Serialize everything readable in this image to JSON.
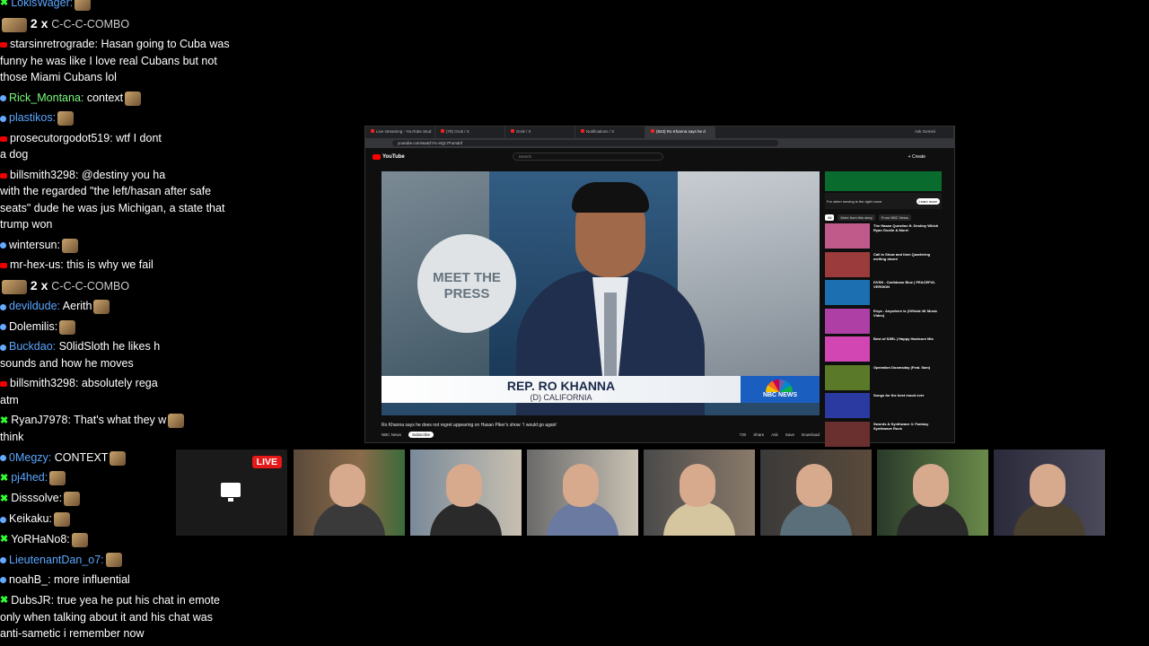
{
  "chat": {
    "top_messages": [
      {
        "platform": "kick",
        "user": "LokisWager",
        "text": "",
        "user_color": "#5aa7ff"
      },
      {
        "platform": "combo",
        "count": "2 x",
        "text": "C-C-C-COMBO"
      },
      {
        "platform": "yt",
        "user": "starsinretrograde",
        "text": "Hasan going to Cuba was funny he was like I love real Cubans but not those Miami Cubans lol",
        "user_color": "#ffffff"
      },
      {
        "platform": "tw",
        "user": "Rick_Montana",
        "text": "context",
        "user_color": "#7cfc7c"
      },
      {
        "platform": "tw",
        "user": "plastikos",
        "text": "",
        "user_color": "#5aa7ff"
      },
      {
        "platform": "yt",
        "user": "prosecutorgodot519",
        "text": "wtf I dont",
        "tail": "a dog",
        "user_color": "#ffffff"
      },
      {
        "platform": "yt",
        "user": "billsmith3298",
        "text": "@destiny you ha",
        "tail": "with the regarded \"the left/hasan after safe seats\" dude he was jus Michigan, a state that trump won",
        "user_color": "#ffffff"
      },
      {
        "platform": "tw",
        "user": "wintersun",
        "text": "",
        "user_color": "#ffffff"
      },
      {
        "platform": "yt",
        "user": "mr-hex-us",
        "text": "this is why we fail",
        "user_color": "#ffffff"
      },
      {
        "platform": "combo",
        "count": "2 x",
        "text": "C-C-C-COMBO"
      },
      {
        "platform": "tw",
        "user": "devildude",
        "text": "Aerith",
        "user_color": "#5aa7ff"
      },
      {
        "platform": "tw",
        "user": "Dolemilis",
        "text": "",
        "user_color": "#ffffff"
      },
      {
        "platform": "tw",
        "user": "Buckdao",
        "text": "S0lidSloth he likes h",
        "tail": "sounds and how he moves",
        "user_color": "#5aa7ff"
      },
      {
        "platform": "yt",
        "user": "billsmith3298",
        "text": "absolutely rega",
        "tail": "atm",
        "user_color": "#ffffff"
      },
      {
        "platform": "kick",
        "user": "RyanJ7978",
        "text": "That's what they w",
        "tail": "think",
        "user_color": "#ffffff"
      },
      {
        "platform": "tw",
        "user": "0Megzy",
        "text": "CONTEXT",
        "user_color": "#5aa7ff"
      },
      {
        "platform": "kick",
        "user": "pj4hed",
        "text": "",
        "user_color": "#5aa7ff"
      },
      {
        "platform": "kick",
        "user": "Disssolve",
        "text": "",
        "user_color": "#ffffff"
      },
      {
        "platform": "tw",
        "user": "Keikaku",
        "text": "",
        "user_color": "#ffffff"
      },
      {
        "platform": "kick",
        "user": "YoRHaNo8",
        "text": "",
        "user_color": "#ffffff"
      },
      {
        "platform": "tw",
        "user": "LieutenantDan_o7",
        "text": "",
        "user_color": "#5aa7ff"
      },
      {
        "platform": "tw",
        "user": "noahB_",
        "text": "more influential",
        "user_color": "#ffffff"
      },
      {
        "platform": "kick",
        "user": "DubsJR",
        "text": "true yea he put his chat in emote only when talking about it and his chat was anti-sametic i remember now",
        "user_color": "#ffffff"
      }
    ]
  },
  "browser": {
    "tabs": [
      "Live streaming - YouTube Stud",
      "(78) Grok / X",
      "Grok / X",
      "Notifications / X",
      "(823) Ro Khanna says he d"
    ],
    "url": "youtube.com/watch?v=6Qc7Fumdnf",
    "right_btn": "Ask Gemini",
    "youtube": {
      "logo": "YouTube",
      "search_placeholder": "Search",
      "create": "+ Create"
    },
    "video": {
      "lower_third_name": "REP. RO KHANNA",
      "lower_third_sub": "(D) CALIFORNIA",
      "network": "NBC NEWS",
      "backdrop": "MEET THE PRESS",
      "title": "Ro Khanna says he does not regret appearing on Hasan Piker's show: 'I would go again'",
      "channel": "NBC News",
      "subscribe": "Subscribe",
      "likes": "730",
      "actions": [
        "Share",
        "Ask",
        "Save",
        "Download"
      ]
    },
    "sidebar": {
      "ad_text": "For when moving is the right move.",
      "ad_cta": "Learn more",
      "chips": [
        "All",
        "More from this story",
        "From NBC News"
      ],
      "recs": [
        {
          "title": "The Hasan Question ft. Destiny Which Ryan Goslin & More!",
          "color": "#c05a8a"
        },
        {
          "title": "Call in Show and then Quartering melting down!",
          "color": "#9c3b3b"
        },
        {
          "title": "DVSN - Caribbean Blue | PEACEFUL VERSION",
          "color": "#1c6fb0"
        },
        {
          "title": "Enya - Anywhere Is (Official 4K Music Video)",
          "color": "#ad3fa5"
        },
        {
          "title": "Best of S3RL | Happy Hardcore Mix",
          "color": "#d246b3"
        },
        {
          "title": "Operation Doomsday (Feat. Sam)",
          "color": "#5a7a2a"
        },
        {
          "title": "Songs for the best mood ever",
          "color": "#2a3aa0"
        },
        {
          "title": "Swords & Synthwave 3: Fantasy Synthwave Rock",
          "color": "#6a3030"
        }
      ]
    }
  },
  "cams": {
    "live_label": "LIVE"
  }
}
